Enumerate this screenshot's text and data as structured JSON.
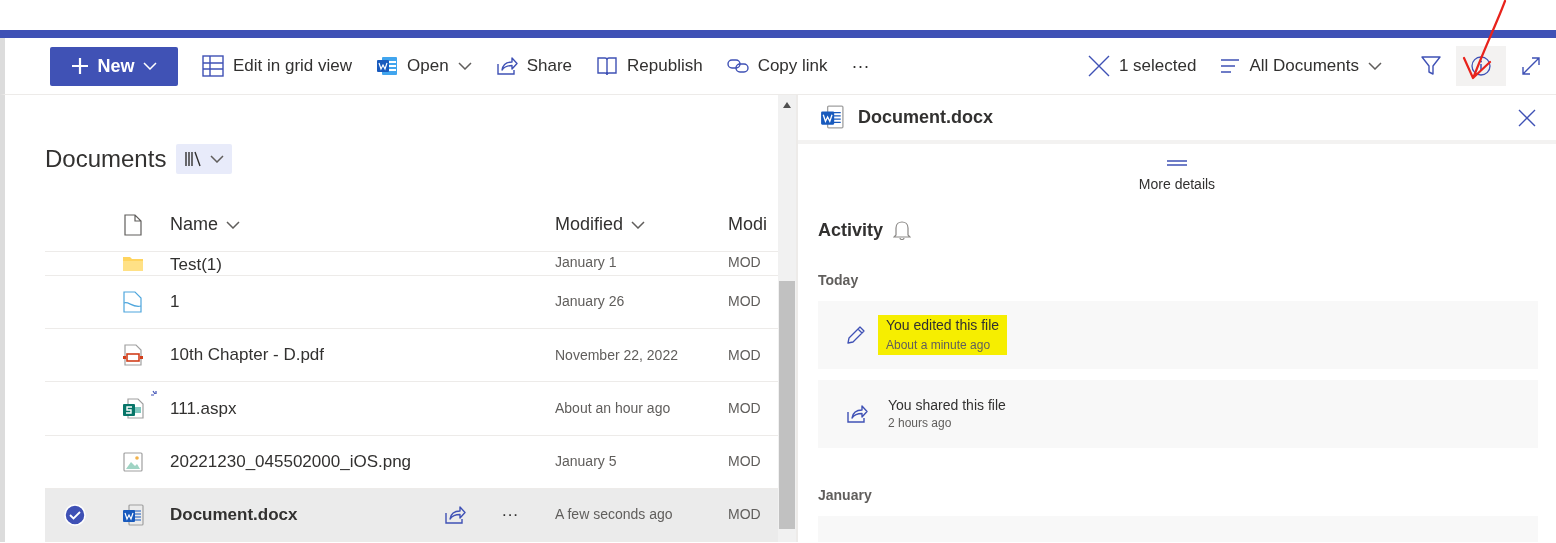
{
  "toolbar": {
    "new_button": {
      "label": "New"
    },
    "commands": [
      {
        "kind": "grid",
        "label": "Edit in grid view",
        "has_caret": false
      },
      {
        "kind": "word",
        "label": "Open",
        "has_caret": true
      },
      {
        "kind": "share",
        "label": "Share",
        "has_caret": false
      },
      {
        "kind": "book",
        "label": "Republish",
        "has_caret": false
      },
      {
        "kind": "link",
        "label": "Copy link",
        "has_caret": false
      }
    ],
    "more_label": "···",
    "selection": "1 selected",
    "view": "All Documents",
    "info_selected": true
  },
  "library": {
    "title": "Documents",
    "columns": [
      {
        "label": "Name",
        "has_caret": true
      },
      {
        "label": "Modified",
        "has_caret": true
      },
      {
        "label": "Modi",
        "has_caret": false
      }
    ],
    "rows": [
      {
        "kind": "folder",
        "name": "Test(1)",
        "modified": "January 1",
        "modified_by": "MOD",
        "selected": false,
        "is_new": false,
        "partial": true
      },
      {
        "kind": "page",
        "name": "1",
        "modified": "January 26",
        "modified_by": "MOD",
        "selected": false,
        "is_new": false,
        "partial": false
      },
      {
        "kind": "pdf",
        "name": "10th Chapter - D.pdf",
        "modified": "November 22, 2022",
        "modified_by": "MOD",
        "selected": false,
        "is_new": false,
        "partial": false
      },
      {
        "kind": "sitepage",
        "name": "111.aspx",
        "modified": "About an hour ago",
        "modified_by": "MOD",
        "selected": false,
        "is_new": true,
        "partial": false
      },
      {
        "kind": "image",
        "name": "20221230_045502000_iOS.png",
        "modified": "January 5",
        "modified_by": "MOD",
        "selected": false,
        "is_new": false,
        "partial": false
      },
      {
        "kind": "word",
        "name": "Document.docx",
        "modified": "A few seconds ago",
        "modified_by": "MOD",
        "selected": true,
        "is_new": false,
        "partial": false
      }
    ],
    "row_more_label": "···"
  },
  "details": {
    "title": "Document.docx",
    "more_details": "More details",
    "activity_title": "Activity",
    "groups": [
      {
        "label": "Today",
        "items": [
          {
            "kind": "edit",
            "text": "You edited this file",
            "time": "About a minute ago",
            "highlighted": true
          },
          {
            "kind": "share",
            "text": "You shared this file",
            "time": "2 hours ago",
            "highlighted": false
          }
        ]
      },
      {
        "label": "January",
        "items": [
          {
            "kind": "stub"
          }
        ]
      }
    ]
  },
  "annotations": [
    {
      "kind": "arrow"
    }
  ]
}
